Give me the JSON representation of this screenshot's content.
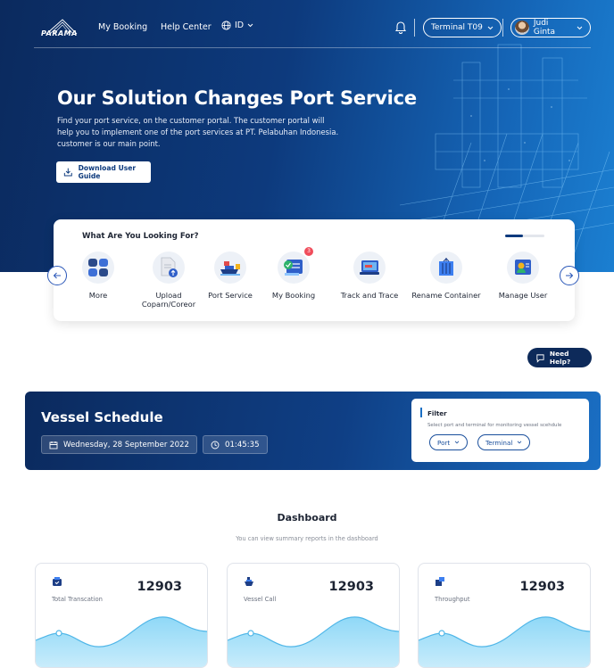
{
  "brand": {
    "logo_text": "PARAMA"
  },
  "nav": {
    "links": [
      "My Booking",
      "Help Center"
    ],
    "language": "ID",
    "terminal": "Terminal T09",
    "user": "Judi Ginta"
  },
  "hero": {
    "title": "Our Solution Changes Port Service",
    "description": "Find your port service, on the customer portal. The customer portal will help you to implement one of the port services at PT. Pelabuhan Indonesia. customer is our main point.",
    "download_label": "Download User Guide"
  },
  "services": {
    "title": "What Are You Looking For?",
    "items": [
      {
        "label": "More",
        "icon": "grid-icon"
      },
      {
        "label": "Upload Coparn/Coreor",
        "icon": "upload-document-icon"
      },
      {
        "label": "Port Service",
        "icon": "ship-icon"
      },
      {
        "label": "My Booking",
        "icon": "booking-icon",
        "badge": "3"
      },
      {
        "label": "Track and Trace",
        "icon": "track-icon"
      },
      {
        "label": "Rename Container",
        "icon": "container-icon"
      },
      {
        "label": "Manage User",
        "icon": "user-card-icon"
      }
    ]
  },
  "help": {
    "label": "Need Help?"
  },
  "vessel": {
    "title": "Vessel Schedule",
    "date": "Wednesday, 28 September 2022",
    "time": "01:45:35",
    "filter": {
      "title": "Filter",
      "description": "Select port and terminal for monitoring vessel scehdule",
      "port_label": "Port",
      "terminal_label": "Terminal"
    }
  },
  "dashboard": {
    "title": "Dashboard",
    "subtitle": "You can view summary reports in the dashboard",
    "stats": [
      {
        "label": "Total Transcation",
        "value": "12903",
        "icon": "transaction-icon"
      },
      {
        "label": "Vessel Call",
        "value": "12903",
        "icon": "vessel-icon"
      },
      {
        "label": "Throughput",
        "value": "12903",
        "icon": "throughput-icon"
      }
    ]
  },
  "colors": {
    "primary": "#0d3a7d",
    "accent": "#1a6fc4",
    "badge": "#f04d5b",
    "chart": "#5fc3ee"
  }
}
